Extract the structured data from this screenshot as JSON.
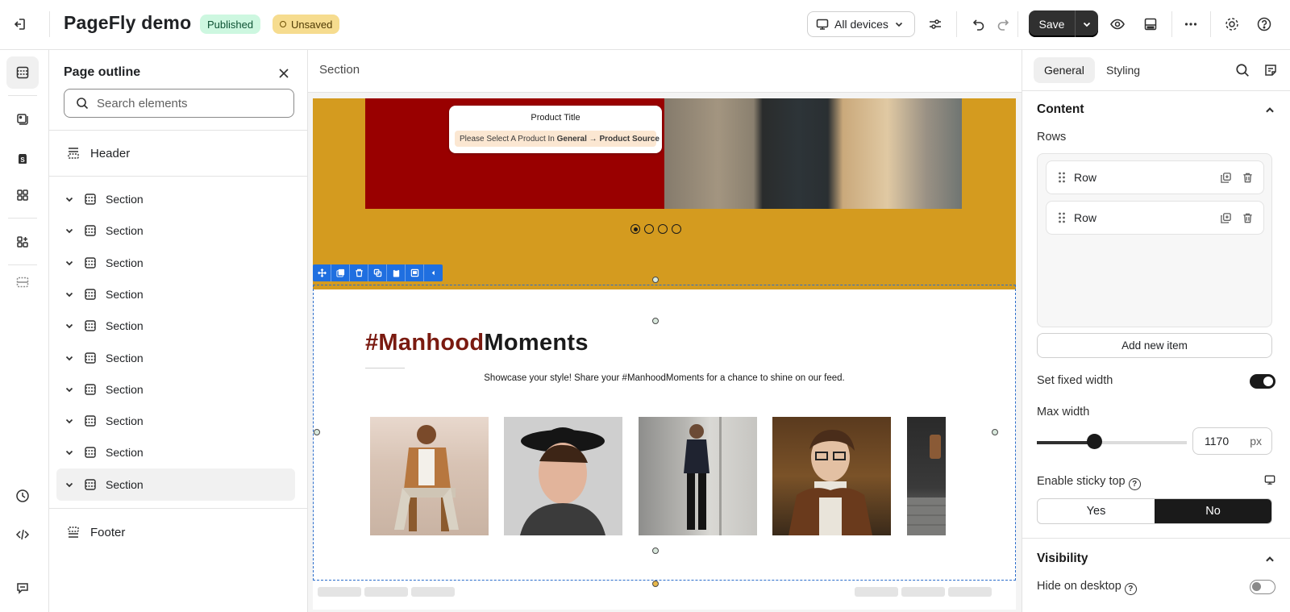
{
  "header": {
    "title": "PageFly demo",
    "status_published": "Published",
    "status_unsaved": "Unsaved",
    "device_select": "All devices",
    "save_label": "Save"
  },
  "outline": {
    "title": "Page outline",
    "search_placeholder": "Search elements",
    "header_label": "Header",
    "sections": [
      "Section",
      "Section",
      "Section",
      "Section",
      "Section",
      "Section",
      "Section",
      "Section",
      "Section",
      "Section"
    ],
    "footer_label": "Footer"
  },
  "canvas": {
    "breadcrumb": "Section",
    "product_title": "Product Title",
    "product_msg_prefix": "Please Select A Product In ",
    "product_msg_path": "General → Product Source",
    "heading_accent": "#Manhood",
    "heading_rest": "Moments",
    "subtitle": "Showcase your style! Share your #ManhoodMoments for a chance to shine on our feed.",
    "carousel_dots": 4,
    "carousel_active": 0
  },
  "properties": {
    "tab_general": "General",
    "tab_styling": "Styling",
    "content_heading": "Content",
    "rows_label": "Rows",
    "rows": [
      "Row",
      "Row"
    ],
    "add_item": "Add new item",
    "fixed_width_label": "Set fixed width",
    "fixed_width_on": true,
    "max_width_label": "Max width",
    "max_width_value": "1170",
    "max_width_unit": "px",
    "sticky_label": "Enable sticky top",
    "sticky_yes": "Yes",
    "sticky_no": "No",
    "sticky_selected": "No",
    "visibility_heading": "Visibility",
    "hide_desktop_label": "Hide on desktop",
    "hide_desktop_on": false
  },
  "colors": {
    "accent_dark": "#303030",
    "banner_gold": "#d49b1f",
    "banner_red": "#990000",
    "selection_blue": "#1f6fe0",
    "heading_accent": "#7a1a10",
    "published_bg": "#cdf7e0",
    "unsaved_bg": "#f6dc8f"
  }
}
